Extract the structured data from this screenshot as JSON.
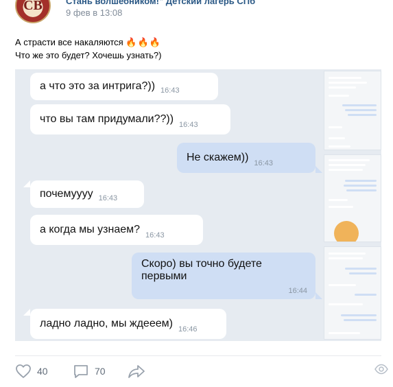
{
  "post": {
    "author": "Стань волшебником!\" Детский лагерь СПб",
    "date": "9 фев в 13:08",
    "avatar_letters": "СВ",
    "text_line1": "А страсти все накаляются",
    "flames": "🔥🔥🔥",
    "text_line2": "Что же это будет? Хочешь узнать?)"
  },
  "messages": [
    {
      "dir": "in",
      "text": "а что это за интрига?))",
      "time": "16:43"
    },
    {
      "dir": "in",
      "text": "что вы там придумали??))",
      "time": "16:43"
    },
    {
      "dir": "out",
      "text": "Не скажем))",
      "time": "16:43"
    },
    {
      "dir": "in",
      "text": "почемуууу",
      "time": "16:43"
    },
    {
      "dir": "in",
      "text": "а когда мы узнаем?",
      "time": "16:43"
    },
    {
      "dir": "out",
      "text_line1": "Скоро)  вы точно будете",
      "text_line2": "первыми",
      "time": "16:44"
    },
    {
      "dir": "in",
      "text": "ладно ладно, мы ждееем)",
      "time": "16:46"
    }
  ],
  "actions": {
    "likes": "40",
    "comments": "70",
    "like_icon": "heart-icon",
    "comment_icon": "comment-icon",
    "share_icon": "share-icon",
    "views_icon": "eye-icon"
  },
  "colors": {
    "link": "#2a5885",
    "meta": "#818c99",
    "chat_bg": "#e6ebf1",
    "bubble_out": "#cfdef4",
    "bubble_in": "#ffffff"
  }
}
